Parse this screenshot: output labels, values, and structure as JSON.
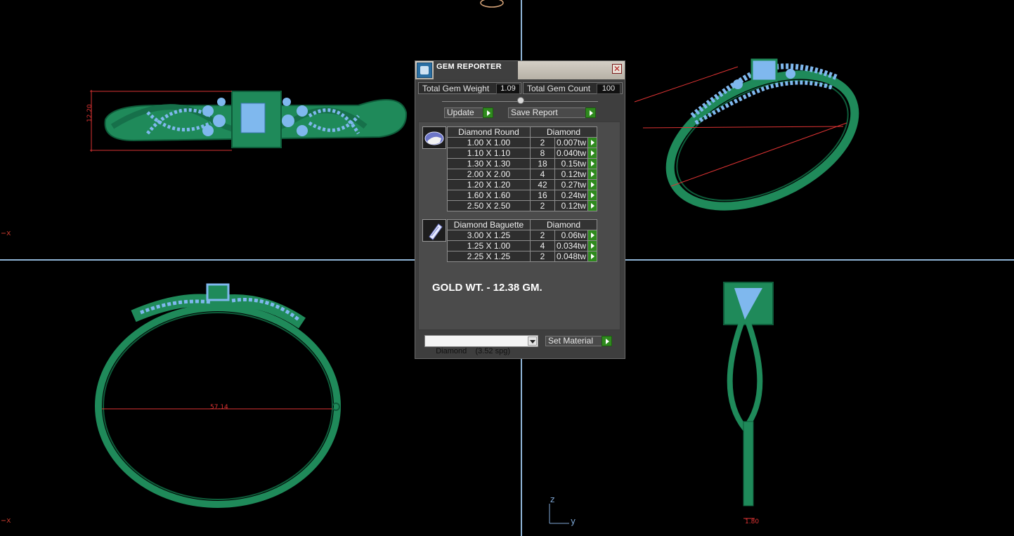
{
  "viewport": {
    "axis_label_x_top": "x",
    "axis_label_x_bottom": "x",
    "axis_label_z": "z",
    "axis_label_y": "y",
    "dim_top_height": "12.20",
    "dim_diameter": "57.14",
    "dim_shank": "1.80",
    "colors": {
      "model": "#1f8a5a",
      "gems": "#7fb8ee",
      "dimension": "#d33333",
      "grid": "#8fb4d6"
    }
  },
  "gem_reporter": {
    "title": "GEM REPORTER",
    "total_weight_label": "Total Gem Weight",
    "total_weight_value": "1.09",
    "total_count_label": "Total Gem Count",
    "total_count_value": "100",
    "update_label": "Update",
    "save_report_label": "Save Report",
    "groups": [
      {
        "shape": "Diamond Round",
        "material": "Diamond",
        "rows": [
          {
            "size": "1.00 X 1.00",
            "count": "2",
            "weight": "0.007tw"
          },
          {
            "size": "1.10 X 1.10",
            "count": "8",
            "weight": "0.040tw"
          },
          {
            "size": "1.30 X 1.30",
            "count": "18",
            "weight": "0.15tw"
          },
          {
            "size": "2.00 X 2.00",
            "count": "4",
            "weight": "0.12tw"
          },
          {
            "size": "1.20 X 1.20",
            "count": "42",
            "weight": "0.27tw"
          },
          {
            "size": "1.60 X 1.60",
            "count": "16",
            "weight": "0.24tw"
          },
          {
            "size": "2.50 X 2.50",
            "count": "2",
            "weight": "0.12tw"
          }
        ]
      },
      {
        "shape": "Diamond Baguette",
        "material": "Diamond",
        "rows": [
          {
            "size": "3.00 X 1.25",
            "count": "2",
            "weight": "0.06tw"
          },
          {
            "size": "1.25 X 1.00",
            "count": "4",
            "weight": "0.034tw"
          },
          {
            "size": "2.25 X 1.25",
            "count": "2",
            "weight": "0.048tw"
          }
        ]
      }
    ],
    "gold_weight": "GOLD WT. - 12.38 GM.",
    "material_select": "Diamond    (3.52 spg)",
    "set_material_label": "Set Material"
  }
}
